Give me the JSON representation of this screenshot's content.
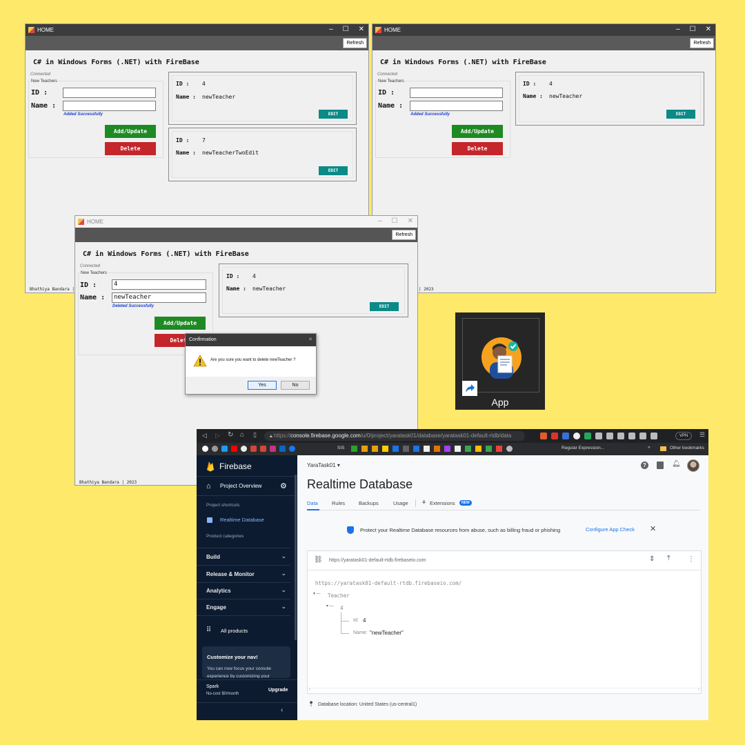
{
  "win1": {
    "title": "HOME",
    "refresh": "Refresh",
    "app_title": "C# in Windows Forms (.NET) with FireBase",
    "connected": "Connected",
    "group": "New Teachers",
    "id_label": "ID :",
    "name_label": "Name :",
    "id_value": "",
    "name_value": "",
    "message": "Added Successfully",
    "add_btn": "Add/Update",
    "delete_btn": "Delete",
    "cards": [
      {
        "id_key": "ID :",
        "id_val": "4",
        "name_key": "Name :",
        "name_val": "newTeacher",
        "edit": "EDIT"
      },
      {
        "id_key": "ID :",
        "id_val": "7",
        "name_key": "Name :",
        "name_val": "newTeacherTwoEdit",
        "edit": "EDIT"
      }
    ],
    "footer": "Bhathiya Bandara |"
  },
  "win2": {
    "title": "HOME",
    "refresh": "Refresh",
    "app_title": "C# in Windows Forms (.NET) with FireBase",
    "connected": "Connected",
    "group": "New Teachers",
    "id_label": "ID :",
    "name_label": "Name :",
    "message": "Added Successfully",
    "add_btn": "Add/Update",
    "delete_btn": "Delete",
    "cards": [
      {
        "id_key": "ID :",
        "id_val": "4",
        "name_key": "Name :",
        "name_val": "newTeacher",
        "edit": "EDIT"
      }
    ],
    "footer": "| 2023"
  },
  "win3": {
    "title": "HOME",
    "refresh": "Refresh",
    "app_title": "C# in Windows Forms (.NET) with FireBase",
    "connected": "Connected",
    "group": "New Teachers",
    "id_label": "ID :",
    "name_label": "Name :",
    "id_value": "4",
    "name_value": "newTeacher",
    "message": "Deleted Successfully",
    "add_btn": "Add/Update",
    "delete_btn": "Delete",
    "cards": [
      {
        "id_key": "ID :",
        "id_val": "4",
        "name_key": "Name :",
        "name_val": "newTeacher",
        "edit": "EDIT"
      }
    ],
    "footer": "Bhathiya Bandara | 2023"
  },
  "dialog": {
    "title": "Confirmation",
    "message": "Are you sure you want to delete newTeacher ?",
    "yes": "Yes",
    "no": "No"
  },
  "app_shortcut": {
    "label": "App"
  },
  "browser": {
    "url_prefix": "https://",
    "url_host": "console.firebase.google.com",
    "url_path": "/u/0/project/yaratask01/database/yaratask01-default-rtdb/data",
    "vpn": "VPN",
    "bookmarks": [
      "SIS",
      "Regular Expression..."
    ],
    "other_bookmarks": "Other bookmarks",
    "sidebar": {
      "brand": "Firebase",
      "overview": "Project Overview",
      "shortcuts_heading": "Project shortcuts",
      "rtdb": "Realtime Database",
      "categories_heading": "Product categories",
      "sections": [
        "Build",
        "Release & Monitor",
        "Analytics",
        "Engage"
      ],
      "all_products": "All products",
      "customize_title": "Customize your nav!",
      "customize_text": "You can now focus your console experience by customizing your",
      "plan": "Spark",
      "plan_desc": "No-cost $0/month",
      "upgrade": "Upgrade"
    },
    "main": {
      "project": "YaraTask01",
      "title": "Realtime Database",
      "tabs": [
        "Data",
        "Rules",
        "Backups",
        "Usage"
      ],
      "extensions": "Extensions",
      "new_badge": "NEW",
      "banner": "Protect your Realtime Database resources from abuse, such as billing fraud or phishing",
      "banner_link": "Configure App Check",
      "db_url": "https://yaratask01-default-rtdb.firebaseio.com",
      "root_url": "https://yaratask01-default-rtdb.firebaseio.com/",
      "node_teacher": "Teacher",
      "node_4": "4",
      "id_key": "Id:",
      "id_val": "4",
      "name_key": "Name:",
      "name_val": "\"newTeacher\"",
      "location": "Database location: United States (us-central1)"
    }
  }
}
